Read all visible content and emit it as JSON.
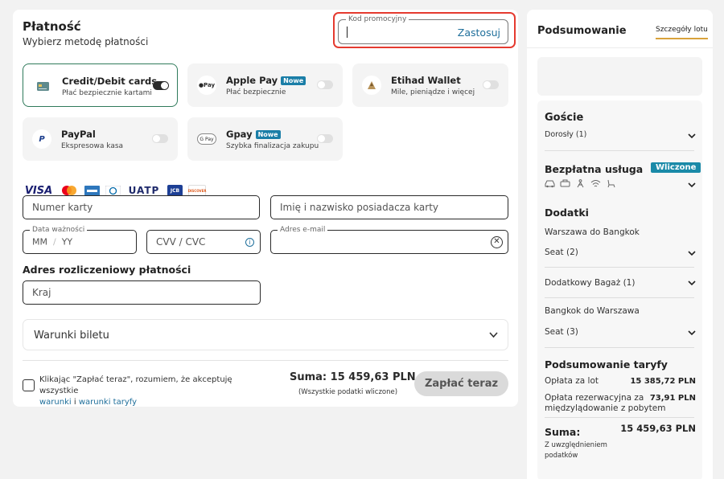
{
  "payment": {
    "title": "Płatność",
    "subtitle": "Wybierz metodę płatności",
    "promo": {
      "legend": "Kod promocyjny",
      "apply": "Zastosuj"
    },
    "methods": [
      {
        "name": "Credit/Debit cards",
        "desc": "Płać bezpiecznie kartami",
        "selected": true
      },
      {
        "name": "Apple Pay",
        "badge": "Nowe",
        "desc": "Płać bezpiecznie",
        "icon_text": "Pay"
      },
      {
        "name": "Etihad Wallet",
        "desc": "Mile, pieniądze i więcej"
      },
      {
        "name": "PayPal",
        "desc": "Ekspresowa kasa",
        "icon_text": "P"
      },
      {
        "name": "Gpay",
        "badge": "Nowe",
        "desc": "Szybka finalizacja zakupu",
        "icon_text": "G Pay"
      }
    ],
    "card_logos": [
      "VISA",
      "UATP",
      "JCB",
      "DISCOVER"
    ],
    "fields": {
      "card_number": "Numer karty",
      "holder": "Imię i nazwisko posiadacza karty",
      "expiry_legend": "Data ważności",
      "expiry_mm": "MM",
      "expiry_sep": "/",
      "expiry_yy": "YY",
      "cvv": "CVV / CVC",
      "email_legend": "Adres e-mail",
      "country": "Kraj"
    },
    "billing_title": "Adres rozliczeniowy płatności",
    "terms_accordion": "Warunki biletu",
    "consent": {
      "text": "Klikając \"Zapłać teraz\", rozumiem, że akceptuję wszystkie",
      "link1": "warunki",
      "and": " i ",
      "link2": "warunki taryfy"
    },
    "total": {
      "label": "Suma: 15 459,63 PLN",
      "note": "(Wszystkie podatki wliczone)"
    },
    "pay_button": "Zapłać teraz"
  },
  "summary": {
    "title": "Podsumowanie",
    "details_link": "Szczegóły lotu",
    "guests": {
      "title": "Goście",
      "adults": "Dorosły (1)"
    },
    "free_service": {
      "title": "Bezpłatna usługa",
      "badge": "Wliczone"
    },
    "addons": {
      "title": "Dodatki",
      "route1": "Warszawa do Bangkok",
      "seat1": "Seat (2)",
      "baggage": "Dodatkowy Bagaż (1)",
      "route2": "Bangkok do Warszawa",
      "seat2": "Seat (3)"
    },
    "fare": {
      "title": "Podsumowanie taryfy",
      "flight_label": "Opłata za lot",
      "flight_amount": "15 385,72 PLN",
      "booking_label_1": "Opłata rezerwacyjna za",
      "booking_label_2": "międzylądowanie z pobytem",
      "booking_amount": "73,91 PLN",
      "total_label": "Suma:",
      "total_amount": "15 459,63 PLN",
      "total_note_1": "Z uwzględnieniem",
      "total_note_2": "podatków"
    }
  },
  "colors": {
    "accent_link": "#1f6f9b",
    "selected_border": "#2f7a5b",
    "promo_highlight": "#e53a2f",
    "badge": "#1a7ea7"
  }
}
